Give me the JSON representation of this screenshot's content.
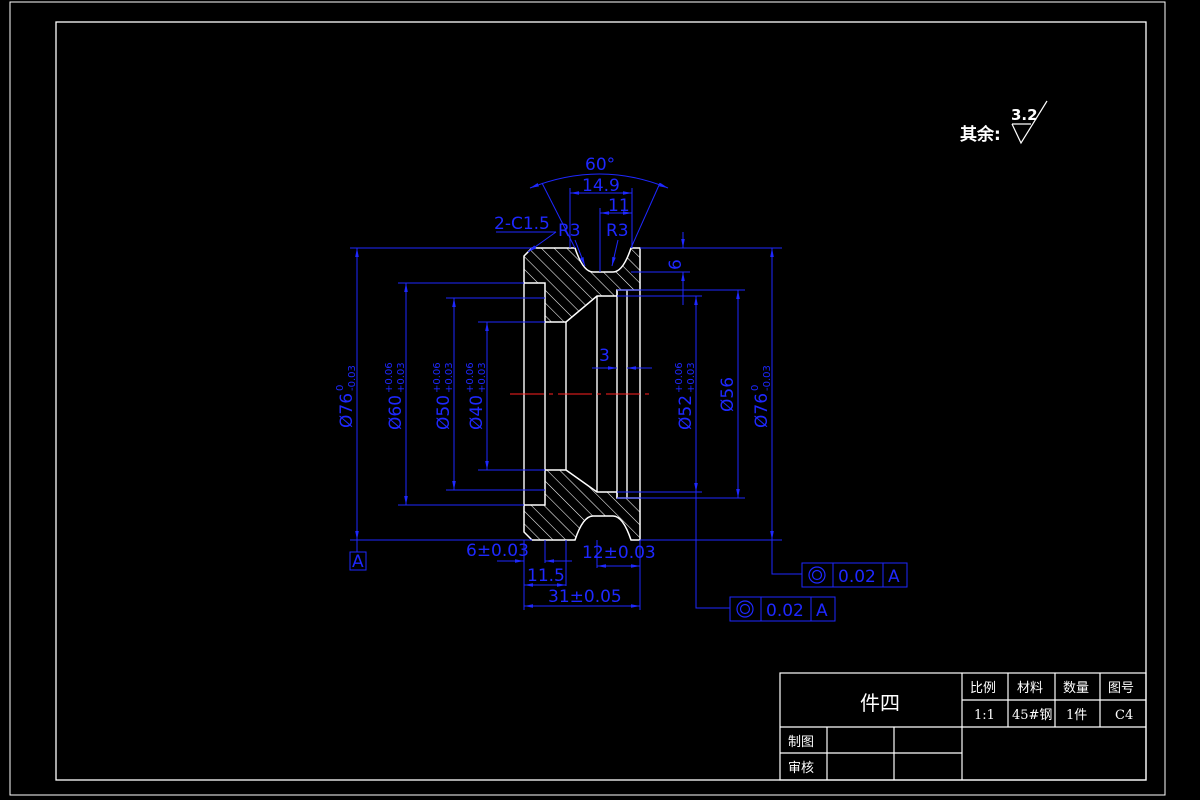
{
  "surface_note": {
    "prefix": "其余:",
    "roughness": "3.2"
  },
  "dimensions": {
    "angle": "60°",
    "groove_width": "14.9",
    "groove_inner": "11",
    "chamfer": "2-C1.5",
    "radius_left": "R3",
    "radius_right": "R3",
    "depth": "6",
    "slot": "3",
    "d76_left": "Ø76",
    "d76_left_upper": "0",
    "d76_left_lower": "-0.03",
    "d60": "Ø60",
    "d60_upper": "+0.06",
    "d60_lower": "+0.03",
    "d50": "Ø50",
    "d50_upper": "+0.06",
    "d50_lower": "+0.03",
    "d40": "Ø40",
    "d40_upper": "+0.06",
    "d40_lower": "+0.03",
    "d52": "Ø52",
    "d52_upper": "+0.06",
    "d52_lower": "+0.03",
    "d56": "Ø56",
    "d76_right": "Ø76",
    "d76_right_upper": "0",
    "d76_right_lower": "-0.03",
    "w6": "6±0.03",
    "w12": "12±0.03",
    "w11_5": "11.5",
    "w31": "31±0.05"
  },
  "datum": "A",
  "tolerance_frames": [
    {
      "value": "0.02",
      "datum": "A"
    },
    {
      "value": "0.02",
      "datum": "A"
    }
  ],
  "title_block": {
    "part_name": "件四",
    "headers": [
      "比例",
      "材料",
      "数量",
      "图号"
    ],
    "values": [
      "1:1",
      "45#钢",
      "1件",
      "C4"
    ],
    "drawn_by_label": "制图",
    "checked_by_label": "审核"
  },
  "colors": {
    "dimension": "#1e28ff",
    "outline": "#ffffff",
    "centerline": "#ff2020",
    "background": "#000000"
  }
}
